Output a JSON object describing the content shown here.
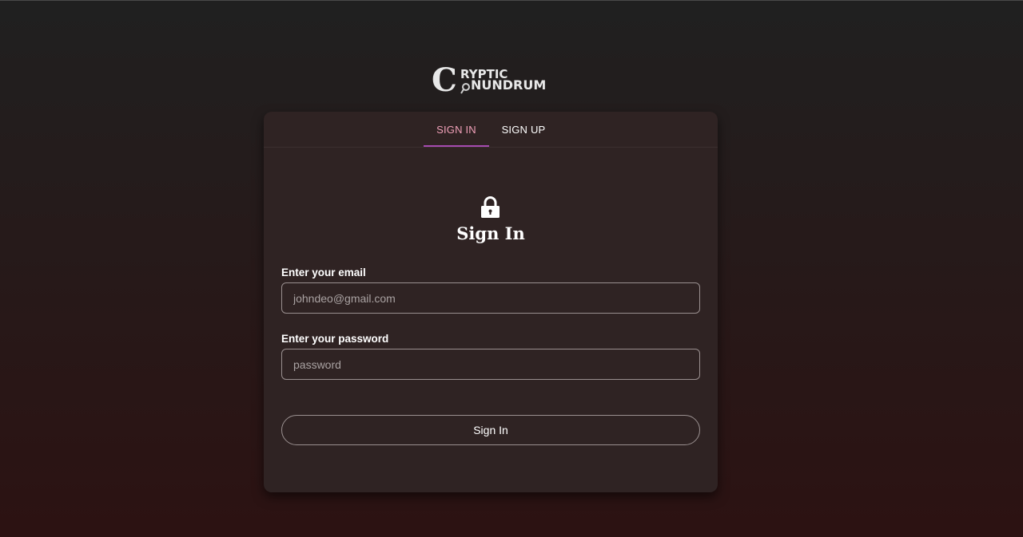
{
  "logo": {
    "line1": "RYPTIC",
    "line2": "NUNDRUM",
    "letter": "C",
    "icon": "magnifier-icon"
  },
  "tabs": [
    {
      "label": "SIGN IN",
      "active": true
    },
    {
      "label": "SIGN UP",
      "active": false
    }
  ],
  "form": {
    "icon": "lock-icon",
    "title": "Sign In",
    "email_label": "Enter your email",
    "email_placeholder": "johndeo@gmail.com",
    "password_label": "Enter your password",
    "password_placeholder": "password",
    "submit_label": "Sign In"
  },
  "colors": {
    "active_tab_text": "#f0a0b8",
    "tab_indicator": "#a64bb0",
    "card_bg": "#2f2323"
  }
}
